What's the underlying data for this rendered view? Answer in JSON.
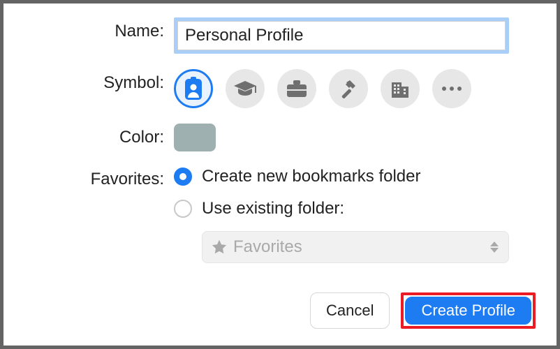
{
  "labels": {
    "name": "Name:",
    "symbol": "Symbol:",
    "color": "Color:",
    "favorites": "Favorites:"
  },
  "name_value": "Personal Profile",
  "symbols": {
    "options": [
      "id-badge",
      "graduation-cap",
      "briefcase",
      "hammer",
      "building",
      "more"
    ],
    "selected_index": 0
  },
  "color": {
    "swatch": "#9fb0b0"
  },
  "favorites": {
    "options": {
      "create_new": "Create new bookmarks folder",
      "use_existing": "Use existing folder:"
    },
    "selected": "create_new",
    "folder_picker": {
      "value": "Favorites",
      "enabled": false
    }
  },
  "buttons": {
    "cancel": "Cancel",
    "create": "Create Profile"
  }
}
